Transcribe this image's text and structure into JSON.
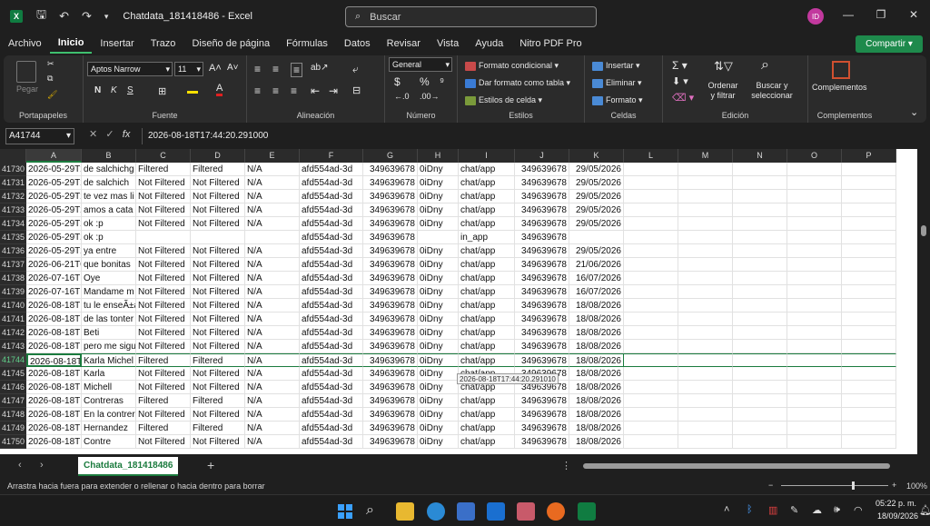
{
  "window": {
    "title": "Chatdata_181418486  -  Excel",
    "search_placeholder": "Buscar",
    "avatar_initials": "ID"
  },
  "menu": [
    "Archivo",
    "Inicio",
    "Insertar",
    "Trazo",
    "Diseño de página",
    "Fórmulas",
    "Datos",
    "Revisar",
    "Vista",
    "Ayuda",
    "Nitro PDF Pro"
  ],
  "share_label": "Compartir",
  "ribbon": {
    "portapapeles": {
      "paste": "Pegar",
      "label": "Portapapeles"
    },
    "fuente": {
      "font": "Aptos Narrow",
      "size": "11",
      "label": "Fuente",
      "bold": "N",
      "italic": "K",
      "underline": "S"
    },
    "alineacion": {
      "label": "Alineación"
    },
    "numero": {
      "format": "General",
      "currency": "$",
      "percent": "%",
      "thousands": "⁹",
      "label": "Número"
    },
    "estilos": {
      "cond": "Formato condicional",
      "table": "Dar formato como tabla",
      "cell": "Estilos de celda",
      "label": "Estilos"
    },
    "celdas": {
      "insert": "Insertar",
      "delete": "Eliminar",
      "format": "Formato",
      "label": "Celdas"
    },
    "edicion": {
      "sort": "Ordenar y filtrar",
      "find": "Buscar y seleccionar",
      "label": "Edición"
    },
    "complementos": {
      "btn": "Complementos",
      "label": "Complementos"
    }
  },
  "formula": {
    "namebox": "A41744",
    "content": "2026-08-18T17:44:20.291000"
  },
  "columns": [
    "A",
    "B",
    "C",
    "D",
    "E",
    "F",
    "G",
    "H",
    "I",
    "J",
    "K",
    "L",
    "M",
    "N",
    "O",
    "P"
  ],
  "rows": [
    {
      "n": "41730",
      "c": [
        "2026-05-29T2",
        "de salchichg",
        "Filtered",
        "Filtered",
        "N/A",
        "afd554ad-3d",
        "349639678",
        "0iDny",
        "chat/app",
        "349639678",
        "29/05/2026"
      ]
    },
    {
      "n": "41731",
      "c": [
        "2026-05-29T2",
        "de salchich",
        "Not Filtered",
        "Not Filtered",
        "N/A",
        "afd554ad-3d",
        "349639678",
        "0iDny",
        "chat/app",
        "349639678",
        "29/05/2026"
      ]
    },
    {
      "n": "41732",
      "c": [
        "2026-05-29T2",
        "te vez mas li",
        "Not Filtered",
        "Not Filtered",
        "N/A",
        "afd554ad-3d",
        "349639678",
        "0iDny",
        "chat/app",
        "349639678",
        "29/05/2026"
      ]
    },
    {
      "n": "41733",
      "c": [
        "2026-05-29T2",
        "amos a cata",
        "Not Filtered",
        "Not Filtered",
        "N/A",
        "afd554ad-3d",
        "349639678",
        "0iDny",
        "chat/app",
        "349639678",
        "29/05/2026"
      ]
    },
    {
      "n": "41734",
      "c": [
        "2026-05-29T2",
        "ok :p",
        "Not Filtered",
        "Not Filtered",
        "N/A",
        "afd554ad-3d",
        "349639678",
        "0iDny",
        "chat/app",
        "349639678",
        "29/05/2026"
      ]
    },
    {
      "n": "41735",
      "c": [
        "2026-05-29T2",
        "ok :p",
        "",
        "",
        "",
        "afd554ad-3d",
        "349639678",
        "",
        "in_app",
        "349639678",
        ""
      ]
    },
    {
      "n": "41736",
      "c": [
        "2026-05-29T2",
        "ya entre",
        "Not Filtered",
        "Not Filtered",
        "N/A",
        "afd554ad-3d",
        "349639678",
        "0iDny",
        "chat/app",
        "349639678",
        "29/05/2026"
      ]
    },
    {
      "n": "41737",
      "c": [
        "2026-06-21T0",
        "que bonitas",
        "Not Filtered",
        "Not Filtered",
        "N/A",
        "afd554ad-3d",
        "349639678",
        "0iDny",
        "chat/app",
        "349639678",
        "21/06/2026"
      ]
    },
    {
      "n": "41738",
      "c": [
        "2026-07-16T1",
        "Oye",
        "Not Filtered",
        "Not Filtered",
        "N/A",
        "afd554ad-3d",
        "349639678",
        "0iDny",
        "chat/app",
        "349639678",
        "16/07/2026"
      ]
    },
    {
      "n": "41739",
      "c": [
        "2026-07-16T1",
        "Mandame m",
        "Not Filtered",
        "Not Filtered",
        "N/A",
        "afd554ad-3d",
        "349639678",
        "0iDny",
        "chat/app",
        "349639678",
        "16/07/2026"
      ]
    },
    {
      "n": "41740",
      "c": [
        "2026-08-18T1",
        "tu le enseÃ±a",
        "Not Filtered",
        "Not Filtered",
        "N/A",
        "afd554ad-3d",
        "349639678",
        "0iDny",
        "chat/app",
        "349639678",
        "18/08/2026"
      ]
    },
    {
      "n": "41741",
      "c": [
        "2026-08-18T1",
        "de las tonter",
        "Not Filtered",
        "Not Filtered",
        "N/A",
        "afd554ad-3d",
        "349639678",
        "0iDny",
        "chat/app",
        "349639678",
        "18/08/2026"
      ]
    },
    {
      "n": "41742",
      "c": [
        "2026-08-18T1",
        "Beti",
        "Not Filtered",
        "Not Filtered",
        "N/A",
        "afd554ad-3d",
        "349639678",
        "0iDny",
        "chat/app",
        "349639678",
        "18/08/2026"
      ]
    },
    {
      "n": "41743",
      "c": [
        "2026-08-18T1",
        "pero me sigu",
        "Not Filtered",
        "Not Filtered",
        "N/A",
        "afd554ad-3d",
        "349639678",
        "0iDny",
        "chat/app",
        "349639678",
        "18/08/2026"
      ]
    },
    {
      "n": "41744",
      "c": [
        "2026-08-18T1",
        "Karla Michel",
        "Filtered",
        "Filtered",
        "N/A",
        "afd554ad-3d",
        "349639678",
        "0iDny",
        "chat/app",
        "349639678",
        "18/08/2026"
      ],
      "selected": true
    },
    {
      "n": "41745",
      "c": [
        "2026-08-18T1",
        "Karla",
        "Not Filtered",
        "Not Filtered",
        "N/A",
        "afd554ad-3d",
        "349639678",
        "0iDny",
        "chat/app",
        "349639678",
        "18/08/2026"
      ]
    },
    {
      "n": "41746",
      "c": [
        "2026-08-18T1",
        "Michell",
        "Not Filtered",
        "Not Filtered",
        "N/A",
        "afd554ad-3d",
        "349639678",
        "0iDny",
        "chat/app",
        "349639678",
        "18/08/2026"
      ]
    },
    {
      "n": "41747",
      "c": [
        "2026-08-18T1",
        "Contreras",
        "Filtered",
        "Filtered",
        "N/A",
        "afd554ad-3d",
        "349639678",
        "0iDny",
        "chat/app",
        "349639678",
        "18/08/2026"
      ]
    },
    {
      "n": "41748",
      "c": [
        "2026-08-18T1",
        "En la contrer",
        "Not Filtered",
        "Not Filtered",
        "N/A",
        "afd554ad-3d",
        "349639678",
        "0iDny",
        "chat/app",
        "349639678",
        "18/08/2026"
      ]
    },
    {
      "n": "41749",
      "c": [
        "2026-08-18T1",
        "Hernandez",
        "Filtered",
        "Filtered",
        "N/A",
        "afd554ad-3d",
        "349639678",
        "0iDny",
        "chat/app",
        "349639678",
        "18/08/2026"
      ]
    },
    {
      "n": "41750",
      "c": [
        "2026-08-18T1",
        "Contre",
        "Not Filtered",
        "Not Filtered",
        "N/A",
        "afd554ad-3d",
        "349639678",
        "0iDny",
        "chat/app",
        "349639678",
        "18/08/2026"
      ]
    }
  ],
  "tooltip": "2026-08-18T17:44:20.291010",
  "sheet_tab": "Chatdata_181418486",
  "status_text": "Arrastra hacia fuera para extender o rellenar o hacia dentro para borrar",
  "zoom": "100%",
  "clock": {
    "time": "05:22 p. m.",
    "date": "18/09/2026"
  },
  "colors": {
    "accent": "#1b7b3e",
    "share": "#1e8a4c"
  }
}
